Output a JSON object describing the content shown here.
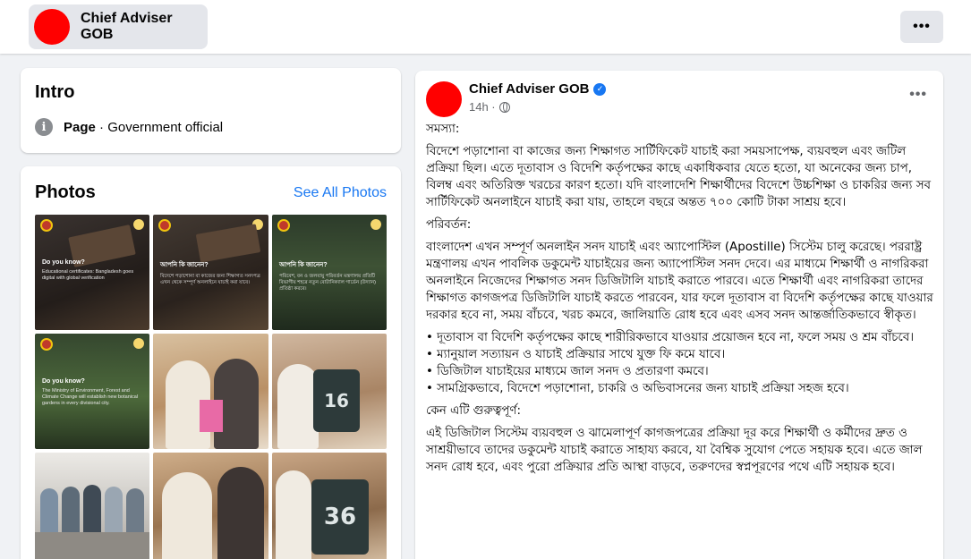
{
  "header": {
    "page_name": "Chief Adviser GOB",
    "more_label": "•••"
  },
  "intro": {
    "title": "Intro",
    "info_icon": "i",
    "category_bold": "Page",
    "category_rest": " · Government official"
  },
  "photos": {
    "title": "Photos",
    "see_all": "See All Photos",
    "tiles": [
      {
        "title": "Do you know?",
        "body": "Educational certificates: Bangladesh goes digital with global verification"
      },
      {
        "title": "আপনি কি জানেন?",
        "body": "বিদেশে পড়াশোনা বা কাজের জন্য শিক্ষাগত সনদপত্র এখন থেকে সম্পূর্ণ অনলাইনে যাচাই করা যাবে।"
      },
      {
        "title": "আপনি কি জানেন?",
        "body": "পরিবেশ, বন ও জলবায়ু পরিবর্তন মন্ত্রণালয় প্রতিটি বিভাগীয় শহরে নতুন বোটানিক্যাল গার্ডেন (উদ্যান) প্রতিষ্ঠা করবে।"
      },
      {
        "title": "Do you know?",
        "body": "The Ministry of Environment, Forest and Climate Change will establish new botanical gardens in every divisional city."
      },
      {
        "title": "",
        "body": ""
      },
      {
        "title": "",
        "body": "16"
      },
      {
        "title": "",
        "body": ""
      },
      {
        "title": "",
        "body": ""
      },
      {
        "title": "",
        "body": "36"
      }
    ]
  },
  "post": {
    "author": "Chief Adviser GOB",
    "time": "14h ·",
    "more_label": "•••",
    "paragraphs": [
      "সমস্যা:",
      "বিদেশে পড়াশোনা বা কাজের জন্য শিক্ষাগত সার্টিফিকেট যাচাই করা সময়সাপেক্ষ, ব্যয়বহুল এবং জটিল প্রক্রিয়া ছিল। এতে দূতাবাস ও বিদেশি কর্তৃপক্ষের কাছে একাধিকবার যেতে হতো, যা অনেকের জন্য চাপ, বিলম্ব এবং অতিরিক্ত খরচের কারণ হতো।  যদি বাংলাদেশি শিক্ষার্থীদের বিদেশে উচ্চশিক্ষা ও চাকরির জন্য সব সার্টিফিকেট অনলাইনে যাচাই করা যায়, তাহলে বছরে অন্তত ৭০০ কোটি টাকা সাশ্রয় হবে।",
      "পরিবর্তন:",
      "বাংলাদেশ এখন সম্পূর্ণ অনলাইন সনদ যাচাই এবং অ্যাপোস্টিল (Apostille) সিস্টেম চালু করেছে। পররাষ্ট্র মন্ত্রণালয় এখন পাবলিক ডকুমেন্ট যাচাইয়ের জন্য অ্যাপোস্টিল সনদ দেবে। এর মাধ্যমে শিক্ষার্থী ও নাগরিকরা অনলাইনে নিজেদের শিক্ষাগত সনদ ডিজিটালি যাচাই করাতে পারবে। এতে শিক্ষার্থী এবং নাগরিকরা তাদের শিক্ষাগত কাগজপত্র ডিজিটালি যাচাই করতে পারবেন, যার ফলে দূতাবাস বা বিদেশি কর্তৃপক্ষের কাছে যাওয়ার দরকার হবে না, সময় বাঁচবে, খরচ কমবে, জালিয়াতি রোধ হবে এবং এসব সনদ আন্তর্জাতিকভাবে স্বীকৃত।"
    ],
    "bullets": [
      "• দূতাবাস বা বিদেশি কর্তৃপক্ষের কাছে শারীরিকভাবে যাওয়ার প্রয়োজন হবে না, ফলে সময় ও শ্রম বাঁচবে।",
      "• ম্যানুয়াল সত্যায়ন ও যাচাই প্রক্রিয়ার সাথে যুক্ত ফি কমে যাবে।",
      "• ডিজিটাল যাচাইয়ের মাধ্যমে জাল সনদ ও প্রতারণা কমবে।",
      "• সামগ্রিকভাবে, বিদেশে পড়াশোনা, চাকরি ও অভিবাসনের জন্য যাচাই প্রক্রিয়া সহজ হবে।"
    ],
    "why_heading": "কেন এটি গুরুত্বপূর্ণ:",
    "why_text": "এই ডিজিটাল সিস্টেম ব্যয়বহুল ও ঝামেলাপূর্ণ কাগজপত্রের প্রক্রিয়া দূর করে শিক্ষার্থী ও কর্মীদের দ্রুত ও সাশ্রয়ীভাবে তাদের ডকুমেন্ট যাচাই করাতে সাহায্য করবে, যা বৈশ্বিক সুযোগ পেতে সহায়ক হবে। এতে জাল সনদ রোধ হবে, এবং পুরো প্রক্রিয়ার প্রতি আস্থা বাড়বে, তরুণদের স্বপ্নপূরণের পথে এটি সহায়ক হবে।"
  },
  "colors": {
    "avatar": "#ff0000",
    "link": "#1877f2",
    "verified": "#1877f2"
  }
}
